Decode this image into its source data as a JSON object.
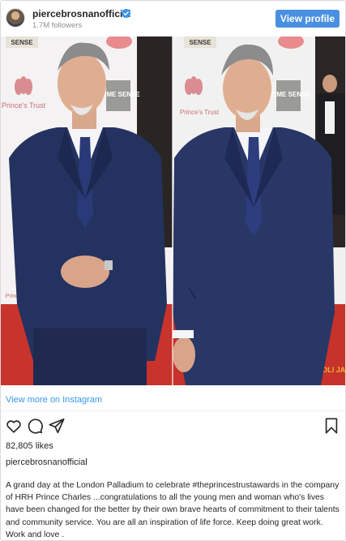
{
  "post": {
    "username": "piercebrosnanofficial",
    "followers": "1.7M followers",
    "view_profile_label": "View profile",
    "verified_icon": "verified-badge-icon",
    "photo_signage": {
      "sense_left": "SENSE",
      "sense_right": "SENSE",
      "home_sense_left": "HOME SENSE",
      "home_sense_right": "HOME SENSE",
      "princes_trust_left": "Prince's Trust",
      "princes_trust_right": "Prince's Trust",
      "princes_left_lower": "Prince's",
      "corner_text": "OLI JAI"
    },
    "view_more_label": "View more on Instagram",
    "likes": "82,805 likes",
    "caption_username": "piercebrosnanofficial",
    "caption": "A grand day at the London Palladium to celebrate #theprincestrustawards in the company of HRH Prince Charles ...congratulations to all the young men and woman who's lives have been changed for the better by their own brave hearts of commitment to their talents and community service. You are all an inspiration of life force. Keep doing great work. Work and love ."
  },
  "icons": [
    "heart-icon",
    "comment-icon",
    "share-icon",
    "bookmark-icon"
  ],
  "colors": {
    "accent": "#4a90e2",
    "link": "#3897f0",
    "suit": "#24325f",
    "carpet": "#c8332c"
  }
}
